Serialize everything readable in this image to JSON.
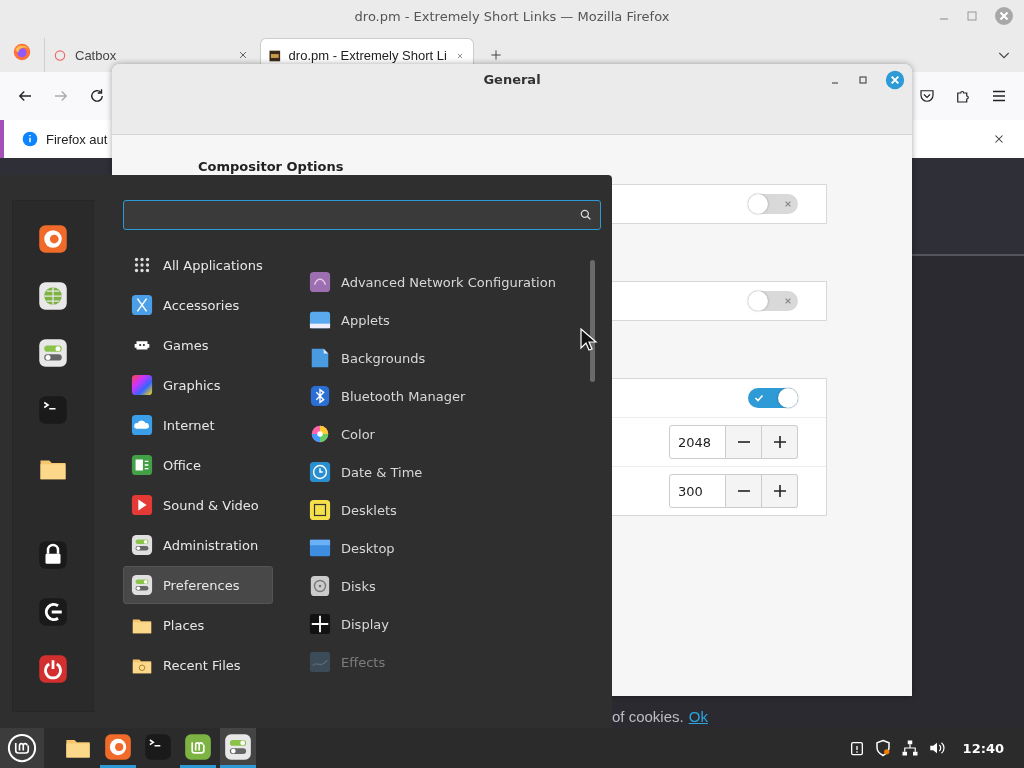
{
  "browser": {
    "title": "dro.pm - Extremely Short Links — Mozilla Firefox",
    "tabs": [
      {
        "label": "Catbox",
        "selected": false
      },
      {
        "label": "dro.pm - Extremely Short Li",
        "selected": true
      }
    ],
    "notification": "Firefox aut",
    "page_text": "of cookies.",
    "page_link": "Ok"
  },
  "dialog": {
    "title": "General",
    "section": "Compositor Options",
    "frames": [
      {
        "rows": [
          {
            "kind": "switch",
            "on": false
          }
        ]
      },
      {
        "rows": [
          {
            "kind": "switch",
            "on": false
          }
        ]
      },
      {
        "rows": [
          {
            "kind": "switch",
            "on": true
          },
          {
            "kind": "spin",
            "value": "2048"
          },
          {
            "kind": "spin",
            "value": "300"
          }
        ]
      }
    ]
  },
  "menu": {
    "categories": [
      {
        "label": "All Applications",
        "selected": false
      },
      {
        "label": "Accessories",
        "selected": false
      },
      {
        "label": "Games",
        "selected": false
      },
      {
        "label": "Graphics",
        "selected": false
      },
      {
        "label": "Internet",
        "selected": false
      },
      {
        "label": "Office",
        "selected": false
      },
      {
        "label": "Sound & Video",
        "selected": false
      },
      {
        "label": "Administration",
        "selected": false
      },
      {
        "label": "Preferences",
        "selected": true
      },
      {
        "label": "Places",
        "selected": false
      },
      {
        "label": "Recent Files",
        "selected": false
      }
    ],
    "apps": [
      {
        "label": "Advanced Network Configuration",
        "faded": false
      },
      {
        "label": "Applets",
        "faded": false
      },
      {
        "label": "Backgrounds",
        "faded": false
      },
      {
        "label": "Bluetooth Manager",
        "faded": false
      },
      {
        "label": "Color",
        "faded": false
      },
      {
        "label": "Date & Time",
        "faded": false
      },
      {
        "label": "Desklets",
        "faded": false
      },
      {
        "label": "Desktop",
        "faded": false
      },
      {
        "label": "Disks",
        "faded": false
      },
      {
        "label": "Display",
        "faded": false
      },
      {
        "label": "Effects",
        "faded": true
      }
    ]
  },
  "taskbar": {
    "launchers": [
      {
        "running": false
      },
      {
        "running": true
      },
      {
        "running": false
      },
      {
        "running": true
      },
      {
        "running": true
      }
    ],
    "clock": "12:40"
  }
}
